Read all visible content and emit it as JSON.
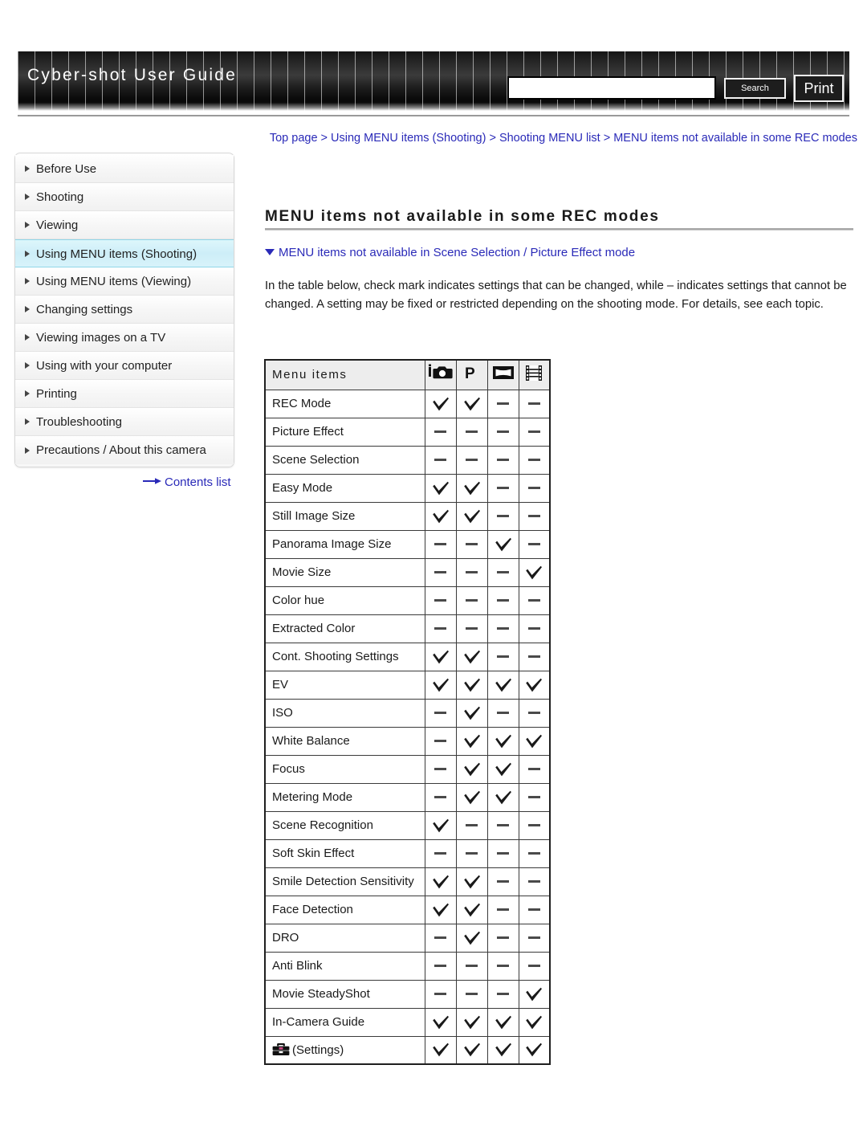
{
  "header": {
    "title": "Cyber-shot User Guide",
    "search_value": "",
    "search_placeholder": "",
    "search_button": "Search",
    "print_button": "Print"
  },
  "sidebar": {
    "items": [
      {
        "label": "Before Use",
        "active": false
      },
      {
        "label": "Shooting",
        "active": false
      },
      {
        "label": "Viewing",
        "active": false
      },
      {
        "label": "Using MENU items (Shooting)",
        "active": true
      },
      {
        "label": "Using MENU items (Viewing)",
        "active": false
      },
      {
        "label": "Changing settings",
        "active": false
      },
      {
        "label": "Viewing images on a TV",
        "active": false
      },
      {
        "label": "Using with your computer",
        "active": false
      },
      {
        "label": "Printing",
        "active": false
      },
      {
        "label": "Troubleshooting",
        "active": false
      },
      {
        "label": "Precautions / About this camera",
        "active": false
      }
    ],
    "contents_list_label": "Contents list"
  },
  "main": {
    "breadcrumb": "Top page > Using MENU items (Shooting) > Shooting MENU list > MENU items not available in some REC modes",
    "page_title": "MENU items not available in some REC modes",
    "section_link": "MENU items not available in Scene Selection / Picture Effect mode",
    "body_text": "In the table below, check mark indicates settings that can be changed, while – indicates settings that cannot be changed. A setting may be fixed or restricted depending on the shooting mode. For details, see each topic."
  },
  "table": {
    "header_label": "Menu items",
    "columns": [
      {
        "icon": "intelligent-auto-icon",
        "alt": "iAuto"
      },
      {
        "icon": "program-auto-icon",
        "alt": "P"
      },
      {
        "icon": "panorama-icon",
        "alt": "Sweep Panorama"
      },
      {
        "icon": "movie-icon",
        "alt": "Movie Mode"
      }
    ],
    "rows": [
      {
        "label": "REC Mode",
        "icon": null,
        "marks": [
          "check",
          "check",
          "dash",
          "dash"
        ]
      },
      {
        "label": "Picture Effect",
        "icon": null,
        "marks": [
          "dash",
          "dash",
          "dash",
          "dash"
        ]
      },
      {
        "label": "Scene Selection",
        "icon": null,
        "marks": [
          "dash",
          "dash",
          "dash",
          "dash"
        ]
      },
      {
        "label": "Easy Mode",
        "icon": null,
        "marks": [
          "check",
          "check",
          "dash",
          "dash"
        ]
      },
      {
        "label": "Still Image Size",
        "icon": null,
        "marks": [
          "check",
          "check",
          "dash",
          "dash"
        ]
      },
      {
        "label": "Panorama Image Size",
        "icon": null,
        "marks": [
          "dash",
          "dash",
          "check",
          "dash"
        ]
      },
      {
        "label": "Movie Size",
        "icon": null,
        "marks": [
          "dash",
          "dash",
          "dash",
          "check"
        ]
      },
      {
        "label": "Color hue",
        "icon": null,
        "marks": [
          "dash",
          "dash",
          "dash",
          "dash"
        ]
      },
      {
        "label": "Extracted Color",
        "icon": null,
        "marks": [
          "dash",
          "dash",
          "dash",
          "dash"
        ]
      },
      {
        "label": "Cont. Shooting Settings",
        "icon": null,
        "marks": [
          "check",
          "check",
          "dash",
          "dash"
        ]
      },
      {
        "label": "EV",
        "icon": null,
        "marks": [
          "check",
          "check",
          "check",
          "check"
        ]
      },
      {
        "label": "ISO",
        "icon": null,
        "marks": [
          "dash",
          "check",
          "dash",
          "dash"
        ]
      },
      {
        "label": "White Balance",
        "icon": null,
        "marks": [
          "dash",
          "check",
          "check",
          "check"
        ]
      },
      {
        "label": "Focus",
        "icon": null,
        "marks": [
          "dash",
          "check",
          "check",
          "dash"
        ]
      },
      {
        "label": "Metering Mode",
        "icon": null,
        "marks": [
          "dash",
          "check",
          "check",
          "dash"
        ]
      },
      {
        "label": "Scene Recognition",
        "icon": null,
        "marks": [
          "check",
          "dash",
          "dash",
          "dash"
        ]
      },
      {
        "label": "Soft Skin Effect",
        "icon": null,
        "marks": [
          "dash",
          "dash",
          "dash",
          "dash"
        ]
      },
      {
        "label": "Smile Detection Sensitivity",
        "icon": null,
        "marks": [
          "check",
          "check",
          "dash",
          "dash"
        ]
      },
      {
        "label": "Face Detection",
        "icon": null,
        "marks": [
          "check",
          "check",
          "dash",
          "dash"
        ]
      },
      {
        "label": "DRO",
        "icon": null,
        "marks": [
          "dash",
          "check",
          "dash",
          "dash"
        ]
      },
      {
        "label": "Anti Blink",
        "icon": null,
        "marks": [
          "dash",
          "dash",
          "dash",
          "dash"
        ]
      },
      {
        "label": "Movie SteadyShot",
        "icon": null,
        "marks": [
          "dash",
          "dash",
          "dash",
          "check"
        ]
      },
      {
        "label": "In-Camera Guide",
        "icon": null,
        "marks": [
          "check",
          "check",
          "check",
          "check"
        ]
      },
      {
        "label": "(Settings)",
        "icon": "toolbox-icon",
        "marks": [
          "check",
          "check",
          "check",
          "check"
        ]
      }
    ]
  },
  "colors": {
    "link": "#2a2ab8",
    "active_nav": "#cdeef8",
    "header_bg": "#151515",
    "table_header_bg": "#ededed"
  }
}
